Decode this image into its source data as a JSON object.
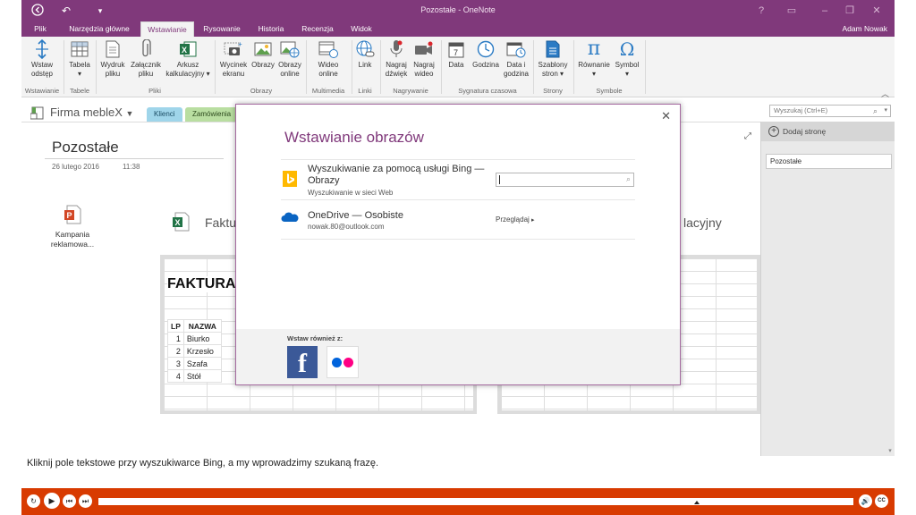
{
  "app": {
    "window_title": "Pozostałe - OneNote",
    "user": "Adam Nowak"
  },
  "ribbon": {
    "tabs": [
      "Plik",
      "Narzędzia główne",
      "Wstawianie",
      "Rysowanie",
      "Historia",
      "Recenzja",
      "Widok"
    ],
    "active_tab": "Wstawianie",
    "groups": {
      "wstawianie": "Wstawianie",
      "tabele": "Tabele",
      "pliki": "Pliki",
      "obrazy": "Obrazy",
      "multimedia": "Multimedia",
      "linki": "Linki",
      "nagrywanie": "Nagrywanie",
      "sygnatura": "Sygnatura czasowa",
      "strony": "Strony",
      "symbole": "Symbole"
    },
    "buttons": {
      "wstaw_odstep": [
        "Wstaw",
        "odstęp"
      ],
      "tabela": [
        "Tabela",
        "▾"
      ],
      "wydruk_pliku": [
        "Wydruk",
        "pliku"
      ],
      "zalacznik_pliku": [
        "Załącznik",
        "pliku"
      ],
      "arkusz": [
        "Arkusz",
        "kalkulacyjny ▾"
      ],
      "wycinek_ekranu": [
        "Wycinek",
        "ekranu"
      ],
      "obrazy": [
        "Obrazy",
        ""
      ],
      "obrazy_online": [
        "Obrazy",
        "online"
      ],
      "wideo_online": [
        "Wideo",
        "online"
      ],
      "link": [
        "Link",
        ""
      ],
      "nagraj_dzwiek": [
        "Nagraj",
        "dźwięk"
      ],
      "nagraj_wideo": [
        "Nagraj",
        "wideo"
      ],
      "data": [
        "Data",
        ""
      ],
      "godzina": [
        "Godzina",
        ""
      ],
      "data_i_godzina": [
        "Data i",
        "godzina"
      ],
      "szablony_stron": [
        "Szablony",
        "stron ▾"
      ],
      "rownanie": [
        "Równanie",
        "▾"
      ],
      "symbol": [
        "Symbol",
        "▾"
      ]
    }
  },
  "notebook": {
    "name": "Firma mebleX",
    "sections": [
      "Klienci",
      "Zamówienia"
    ],
    "search_placeholder": "Wyszukaj (Ctrl+E)"
  },
  "page": {
    "title": "Pozostałe",
    "date": "26 lutego 2016",
    "time": "11:38",
    "attachment_label": [
      "Kampania",
      "reklamowa..."
    ],
    "embedded_label_left": "Faktu",
    "embedded_label_right": "lacyjny",
    "invoice_heading": "FAKTURA V",
    "table_headers": [
      "LP",
      "NAZWA"
    ],
    "table_rows": [
      [
        "1",
        "Biurko"
      ],
      [
        "2",
        "Krzesło"
      ],
      [
        "3",
        "Szafa"
      ],
      [
        "4",
        "Stół"
      ]
    ]
  },
  "pages_panel": {
    "add_page": "Dodaj stronę",
    "pages": [
      "Pozostałe"
    ]
  },
  "dialog": {
    "title": "Wstawianie obrazów",
    "bing": {
      "name_line1": "Wyszukiwanie za pomocą usługi Bing —",
      "name_line2": "Obrazy",
      "sub": "Wyszukiwanie w sieci Web"
    },
    "onedrive": {
      "name": "OneDrive — Osobiste",
      "sub": "nowak.80@outlook.com",
      "browse": "Przeglądaj"
    },
    "also_from": "Wstaw również z:",
    "colors": {
      "accent": "#80397b",
      "facebook": "#3b5998",
      "flickr_blue": "#0063dc",
      "flickr_pink": "#ff0084"
    }
  },
  "caption": "Kliknij pole tekstowe przy wyszukiwarce Bing, a my wprowadzimy szukaną frazę.",
  "player": {
    "accent": "#d83b01"
  }
}
